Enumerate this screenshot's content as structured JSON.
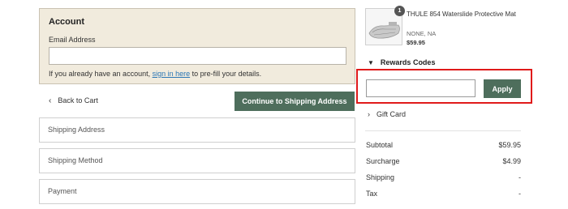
{
  "account": {
    "title": "Account",
    "email_label": "Email Address",
    "email_value": "",
    "hint_before": "If you already have an account, ",
    "hint_link": "sign in here",
    "hint_after": " to pre-fill your details."
  },
  "nav": {
    "back_label": "Back to Cart",
    "continue_label": "Continue to Shipping Address"
  },
  "steps": [
    "Shipping Address",
    "Shipping Method",
    "Payment"
  ],
  "product": {
    "quantity": "1",
    "name": "THULE 854 Waterslide Protective Mat",
    "variant": "NONE, NA",
    "price": "$59.95"
  },
  "rewards": {
    "label": "Rewards Codes",
    "input_value": "",
    "apply_label": "Apply"
  },
  "giftcard": {
    "label": "Gift Card"
  },
  "totals": [
    {
      "label": "Subtotal",
      "value": "$59.95"
    },
    {
      "label": "Surcharge",
      "value": "$4.99"
    },
    {
      "label": "Shipping",
      "value": "-"
    },
    {
      "label": "Tax",
      "value": "-"
    }
  ],
  "colors": {
    "account_bg": "#f1ebdd",
    "button_green": "#4e6e5c",
    "highlight_red": "#e01a1a",
    "link_blue": "#2a76b5"
  }
}
